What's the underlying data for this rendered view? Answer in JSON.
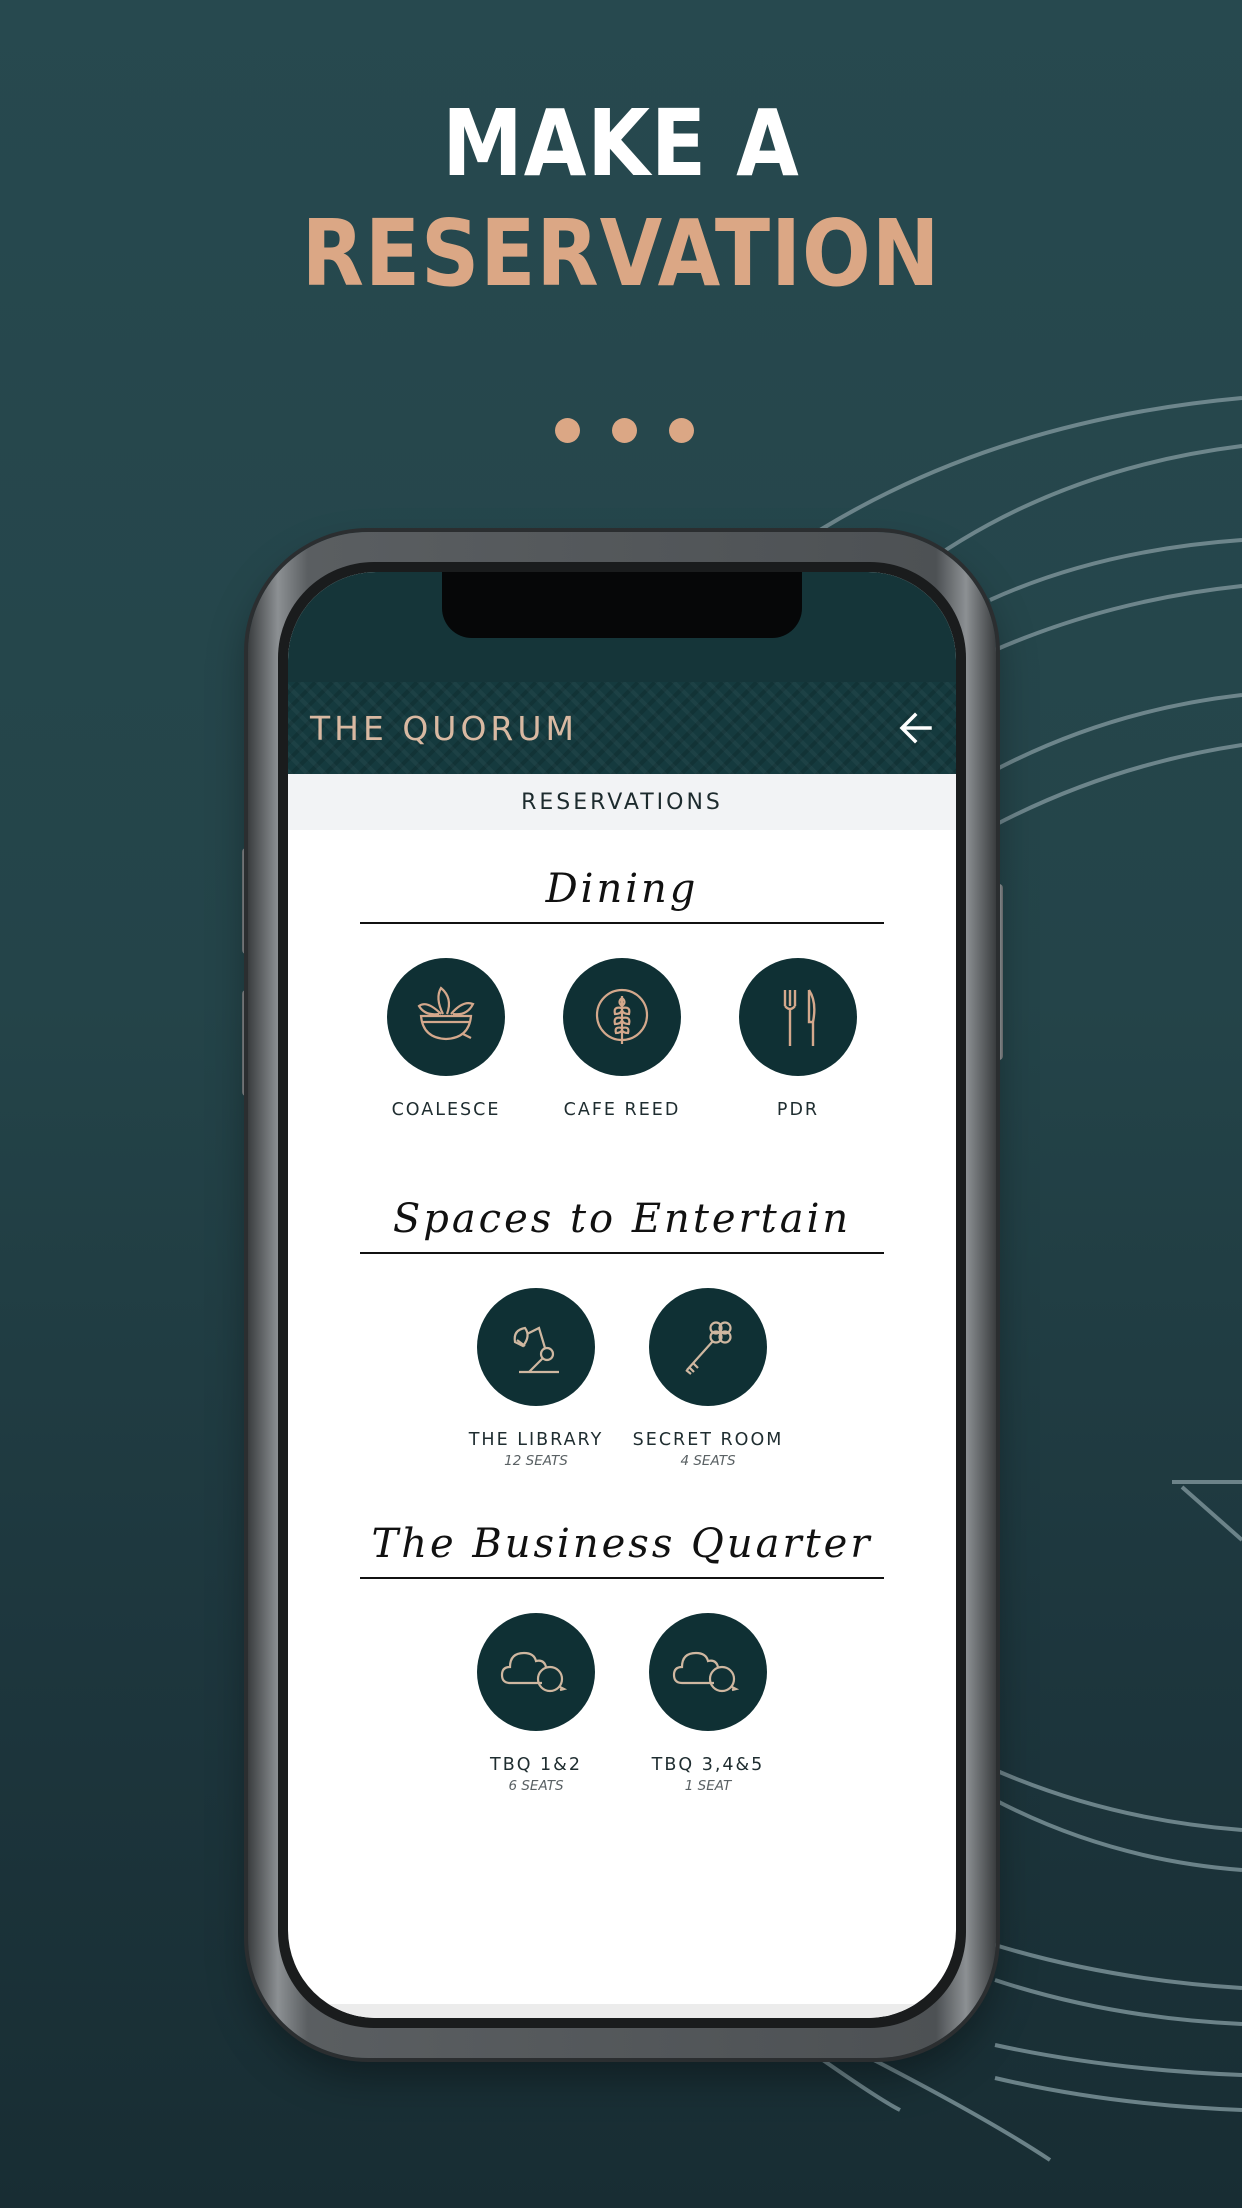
{
  "promo": {
    "headline_line1": "MAKE A",
    "headline_line2": "RESERVATION",
    "accent_color": "#dba785",
    "background_color": "#244449",
    "pager_dots": 3
  },
  "app": {
    "brand": "THE QUORUM",
    "back_icon": "arrow-left-icon",
    "page_title": "RESERVATIONS",
    "header_color": "#153a3e",
    "brand_color": "#d9b9a2"
  },
  "sections": [
    {
      "title": "Dining",
      "items": [
        {
          "label": "COALESCE",
          "icon": "salad-bowl-icon",
          "seats": null
        },
        {
          "label": "CAFE REED",
          "icon": "wheat-icon",
          "seats": null
        },
        {
          "label": "PDR",
          "icon": "fork-knife-icon",
          "seats": null
        }
      ]
    },
    {
      "title": "Spaces to Entertain",
      "items": [
        {
          "label": "THE LIBRARY",
          "icon": "desk-lamp-icon",
          "seats": "12 SEATS"
        },
        {
          "label": "SECRET ROOM",
          "icon": "key-icon",
          "seats": "4 SEATS"
        }
      ]
    },
    {
      "title": "The Business Quarter",
      "items": [
        {
          "label": "TBQ 1&2",
          "icon": "cloud-chat-icon",
          "seats": "6 SEATS"
        },
        {
          "label": "TBQ 3,4&5",
          "icon": "cloud-chat-icon",
          "seats": "1 SEAT"
        }
      ]
    }
  ]
}
